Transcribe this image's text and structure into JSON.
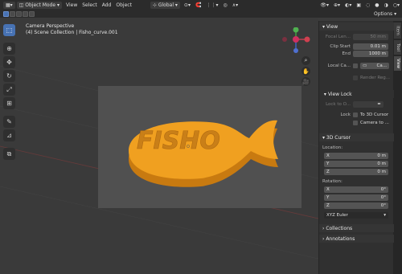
{
  "header": {
    "mode": "Object Mode",
    "menus": [
      "View",
      "Select",
      "Add",
      "Object"
    ],
    "orientation": "Global",
    "options_label": "Options"
  },
  "viewport": {
    "title_line1": "Camera Perspective",
    "title_line2": "(4) Scene Collection | Fisho_curve.001",
    "object_text": "FISHO",
    "colors": {
      "object": "#f0a020",
      "object_dark": "#c87a10",
      "camera_bg": "#505050"
    }
  },
  "sidebar_tabs": [
    "Item",
    "Tool",
    "View"
  ],
  "view_panel": {
    "header": "View",
    "focal_length_label": "Focal Len...",
    "focal_length_value": "50 mm",
    "clip_start_label": "Clip Start",
    "clip_start_value": "0.01 m",
    "end_label": "End",
    "end_value": "1000 m",
    "local_camera_label": "Local Ca...",
    "local_camera_value": "Ca...",
    "render_region_label": "Render Reg..."
  },
  "view_lock": {
    "header": "View Lock",
    "lock_to_object_label": "Lock to O...",
    "lock_label": "Lock",
    "to_3d_cursor": "To 3D Cursor",
    "camera_to": "Camera to ..."
  },
  "cursor_3d": {
    "header": "3D Cursor",
    "location_label": "Location:",
    "location": [
      {
        "axis": "X",
        "value": "0 m"
      },
      {
        "axis": "Y",
        "value": "0 m"
      },
      {
        "axis": "Z",
        "value": "0 m"
      }
    ],
    "rotation_label": "Rotation:",
    "rotation": [
      {
        "axis": "X",
        "value": "0°"
      },
      {
        "axis": "Y",
        "value": "0°"
      },
      {
        "axis": "Z",
        "value": "0°"
      }
    ],
    "rotation_mode": "XYZ Euler"
  },
  "collections_label": "Collections",
  "annotations_label": "Annotations"
}
